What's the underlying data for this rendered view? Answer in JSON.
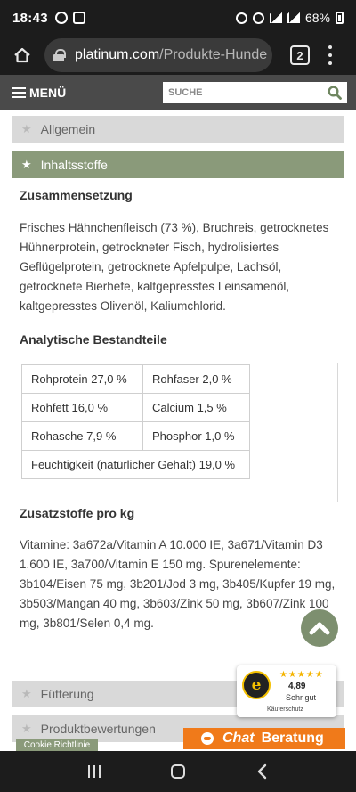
{
  "status_bar": {
    "time": "18:43",
    "battery": "68%"
  },
  "browser": {
    "url_host": "platinum.com",
    "url_path": "/Produkte-Hunde",
    "tab_count": "2"
  },
  "header": {
    "menu_label": "MENÜ",
    "search_placeholder": "SUCHE"
  },
  "accordion": {
    "general": "Allgemein",
    "ingredients": "Inhaltsstoffe",
    "feeding": "Fütterung",
    "reviews": "Produktbewertungen"
  },
  "composition": {
    "title": "Zusammensetzung",
    "text": "Frisches Hähnchenfleisch (73 %), Bruchreis, getrocknetes Hühnerprotein, getrockneter Fisch, hydrolisiertes Geflügelprotein, getrocknete Apfelpulpe, Lachsöl, getrocknete Bierhefe, kaltgepresstes Leinsamenöl, kaltgepresstes Olivenöl, Kaliumchlorid."
  },
  "analysis": {
    "title": "Analytische Bestandteile",
    "rows": [
      [
        "Rohprotein 27,0 %",
        "Rohfaser 2,0 %"
      ],
      [
        "Rohfett 16,0 %",
        "Calcium 1,5 %"
      ],
      [
        "Rohasche 7,9 %",
        "Phosphor 1,0 %"
      ]
    ],
    "last_row": "Feuchtigkeit (natürlicher Gehalt) 19,0 %"
  },
  "additives": {
    "title": "Zusatzstoffe pro kg",
    "text": "Vitamine: 3a672a/Vitamin A 10.000 IE, 3a671/Vitamin D3 1.600 IE, 3a700/Vitamin E 150 mg. Spurenelemente: 3b104/Eisen 75 mg, 3b201/Jod 3 mg, 3b405/Kupfer 19 mg, 3b503/Mangan 40 mg, 3b603/Zink 50 mg, 3b607/Zink 100 mg, 3b801/Selen 0,4 mg."
  },
  "trust_badge": {
    "seal_letter": "e",
    "stars": "★★★★★",
    "score": "4,89",
    "rating": "Sehr gut",
    "caption": "Käuferschutz"
  },
  "cookie_label": "Cookie Richtlinie",
  "chat": {
    "part1": "Chat",
    "part2": "Beratung"
  },
  "colors": {
    "accent_green": "#8a9a7a",
    "chat_orange": "#f07a1a",
    "header_grey": "#4a4a4a"
  }
}
